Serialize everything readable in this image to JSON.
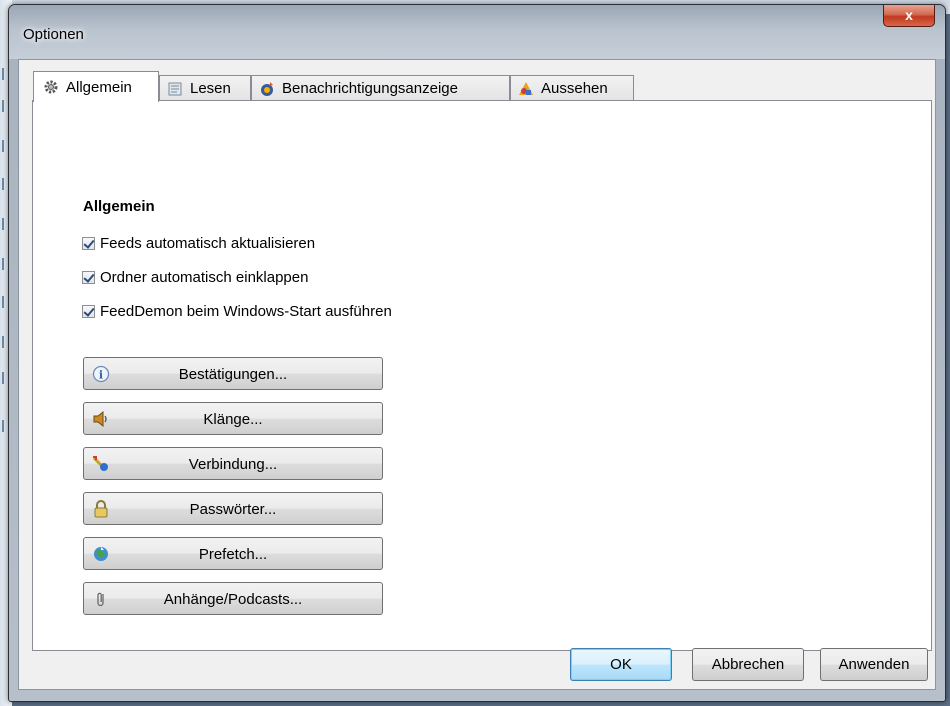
{
  "window": {
    "title": "Optionen",
    "close_label": "x"
  },
  "tabs": [
    {
      "label": "Allgemein",
      "icon": "gear-icon",
      "active": true
    },
    {
      "label": "Lesen",
      "icon": "reading-icon",
      "active": false
    },
    {
      "label": "Benachrichtigungsanzeige",
      "icon": "notification-icon",
      "active": false
    },
    {
      "label": "Aussehen",
      "icon": "appearance-icon",
      "active": false
    }
  ],
  "general": {
    "heading": "Allgemein",
    "checkboxes": [
      {
        "label": "Feeds automatisch aktualisieren",
        "checked": true
      },
      {
        "label": "Ordner automatisch einklappen",
        "checked": true
      },
      {
        "label": "FeedDemon beim Windows-Start ausführen",
        "checked": true
      }
    ],
    "buttons": [
      {
        "label": "Bestätigungen...",
        "icon": "info-icon"
      },
      {
        "label": "Klänge...",
        "icon": "speaker-icon"
      },
      {
        "label": "Verbindung...",
        "icon": "connection-icon"
      },
      {
        "label": "Passwörter...",
        "icon": "lock-icon"
      },
      {
        "label": "Prefetch...",
        "icon": "prefetch-icon"
      },
      {
        "label": "Anhänge/Podcasts...",
        "icon": "paperclip-icon"
      }
    ]
  },
  "dialog_buttons": {
    "ok": "OK",
    "cancel": "Abbrechen",
    "apply": "Anwenden"
  }
}
